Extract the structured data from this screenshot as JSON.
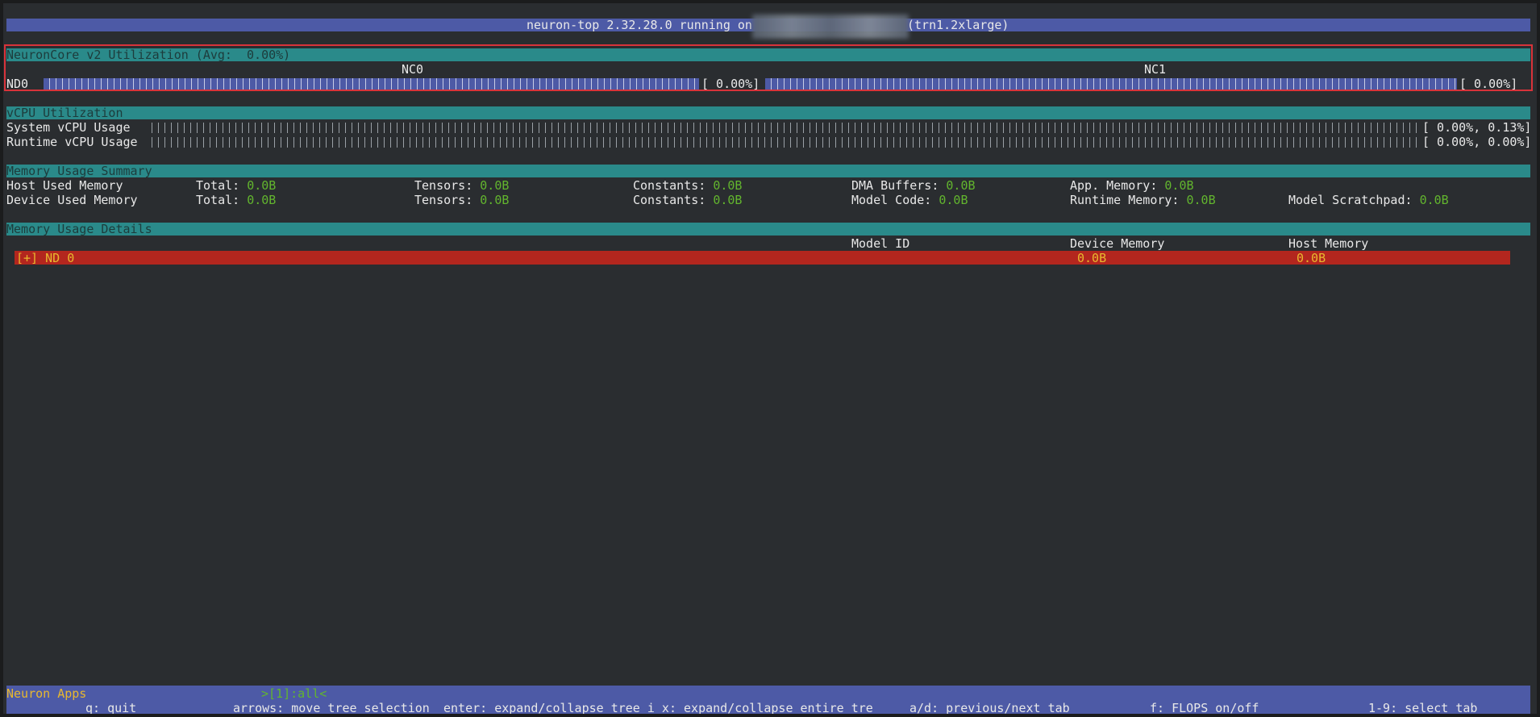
{
  "title": {
    "prefix": "neuron-top 2.32.28.0 running on",
    "instance": "(trn1.2xlarge)"
  },
  "neuroncore": {
    "header": "NeuronCore v2 Utilization (Avg:  0.00%)",
    "device": "ND0",
    "cores": [
      {
        "label": "NC0",
        "value": "[ 0.00%]",
        "utilization": 0.0
      },
      {
        "label": "NC1",
        "value": "[ 0.00%]",
        "utilization": 0.0
      }
    ]
  },
  "vcpu": {
    "header": "vCPU Utilization",
    "rows": [
      {
        "label": "System vCPU Usage",
        "value": "[ 0.00%, 0.13%]"
      },
      {
        "label": "Runtime vCPU Usage",
        "value": "[ 0.00%, 0.00%]"
      }
    ]
  },
  "memory_summary": {
    "header": "Memory Usage Summary",
    "host": {
      "label": "Host Used Memory",
      "total_label": "Total:",
      "total": "0.0B",
      "tensors_label": "Tensors:",
      "tensors": "0.0B",
      "constants_label": "Constants:",
      "constants": "0.0B",
      "dma_label": "DMA Buffers:",
      "dma": "0.0B",
      "app_label": "App. Memory:",
      "app": "0.0B"
    },
    "device": {
      "label": "Device Used Memory",
      "total_label": "Total:",
      "total": "0.0B",
      "tensors_label": "Tensors:",
      "tensors": "0.0B",
      "constants_label": "Constants:",
      "constants": "0.0B",
      "model_code_label": "Model Code:",
      "model_code": "0.0B",
      "runtime_label": "Runtime Memory:",
      "runtime": "0.0B",
      "scratch_label": "Model Scratchpad:",
      "scratch": "0.0B"
    }
  },
  "memory_details": {
    "header": "Memory Usage Details",
    "columns": [
      "Model ID",
      "Device Memory",
      "Host Memory"
    ],
    "row": {
      "name": "[+] ND 0",
      "device_memory": "0.0B",
      "host_memory": "0.0B"
    }
  },
  "footer": {
    "app_label": "Neuron Apps",
    "tab": ">[1]:all<",
    "keys": [
      "q: quit",
      "arrows: move tree selection",
      "enter: expand/collapse tree i x: expand/collapse entire tre",
      "a/d: previous/next tab",
      "f: FLOPS on/off",
      "1-9: select tab"
    ]
  },
  "colors": {
    "title_bar": "#4d5aa6",
    "section_header": "#2a8a8a",
    "value_green": "#62b52e",
    "selected_row": "#b3261e",
    "highlight_box": "#d8333a"
  }
}
